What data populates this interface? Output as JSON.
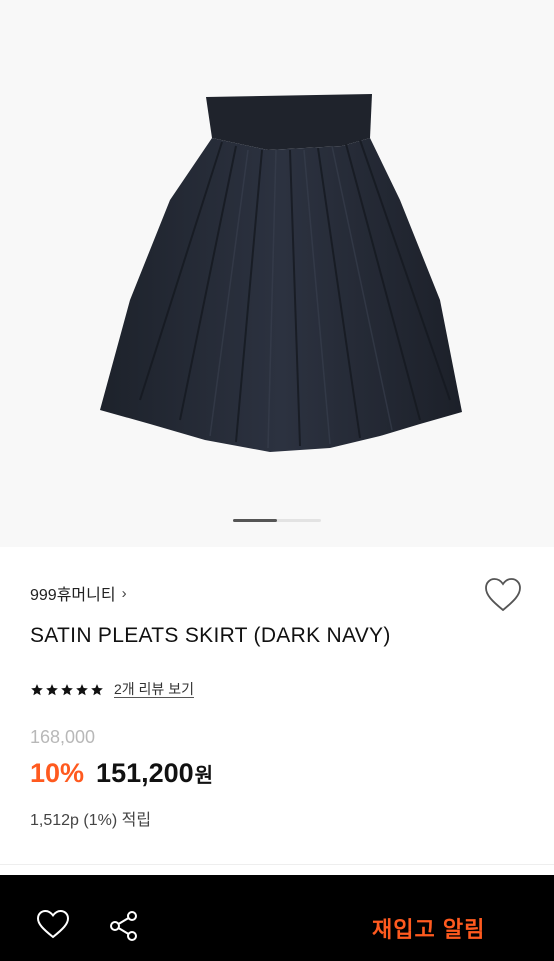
{
  "product": {
    "brand": "999휴머니티",
    "brand_chevron": "›",
    "name": "SATIN PLEATS SKIRT (DARK NAVY)",
    "rating_stars": 5,
    "review_link": "2개 리뷰 보기",
    "original_price": "168,000",
    "discount": "10%",
    "price": "151,200",
    "currency": "원",
    "points": "1,512p (1%) 적립"
  },
  "gallery": {
    "current_slide": 1,
    "total_slides": 2
  },
  "bottom_bar": {
    "restock_label": "재입고 알림"
  },
  "colors": {
    "accent": "#ff5a1f",
    "bar": "#000000",
    "skirt": "#262b36"
  },
  "icons": {
    "wishlist": "heart-outline-icon",
    "share": "share-icon",
    "star": "star-icon",
    "chevron": "chevron-right-icon"
  }
}
